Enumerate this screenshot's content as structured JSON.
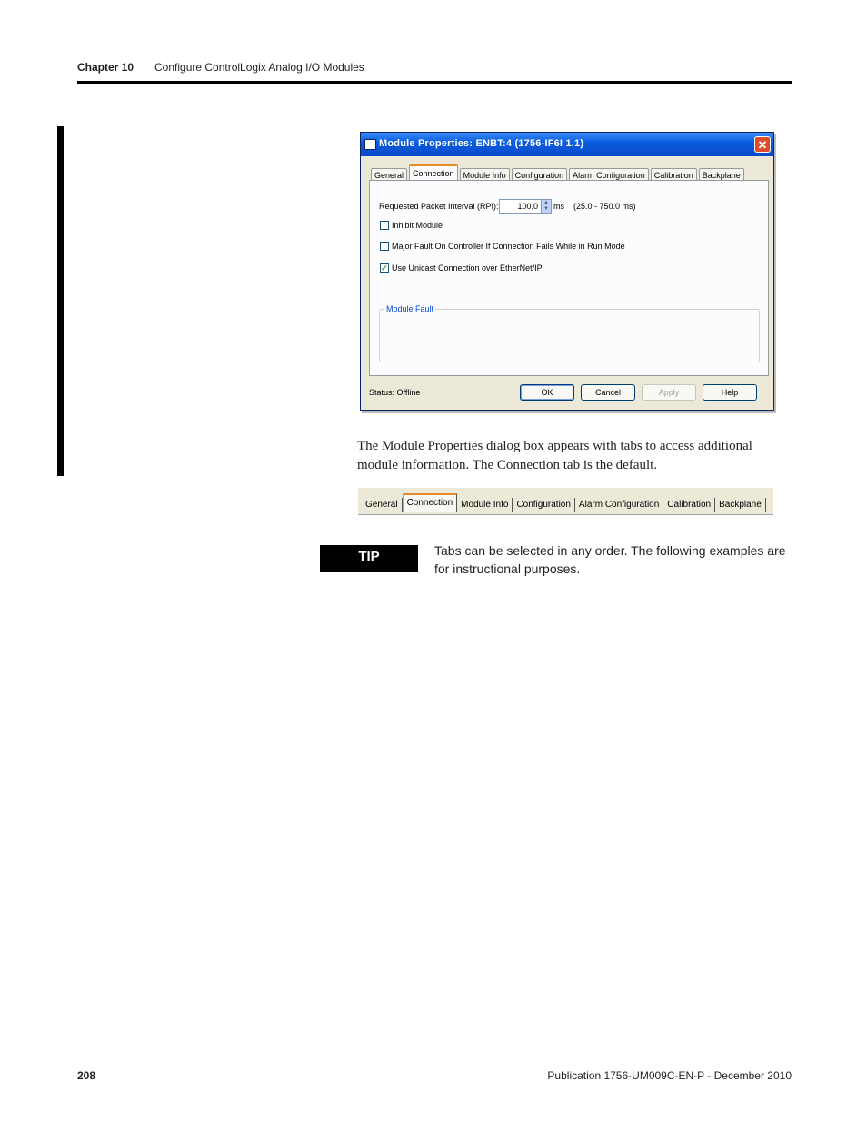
{
  "header": {
    "chapter": "Chapter 10",
    "title": "Configure ControlLogix Analog I/O Modules"
  },
  "dialog": {
    "title": "Module Properties: ENBT:4 (1756-IF6I 1.1)",
    "close_glyph": "✕",
    "tabs": [
      "General",
      "Connection",
      "Module Info",
      "Configuration",
      "Alarm Configuration",
      "Calibration",
      "Backplane"
    ],
    "active_tab": "Connection",
    "rpi": {
      "label": "Requested Packet Interval (RPI):",
      "value": "100.0",
      "unit": "ms",
      "range": "(25.0 - 750.0 ms)"
    },
    "options": [
      {
        "label": "Inhibit Module",
        "checked": false
      },
      {
        "label": "Major Fault On Controller If Connection Fails While in Run Mode",
        "checked": false
      },
      {
        "label": "Use Unicast Connection over EtherNet/IP",
        "checked": true
      }
    ],
    "check_glyph": "✓",
    "module_fault_label": "Module Fault",
    "status": "Status:  Offline",
    "buttons": {
      "ok": "OK",
      "cancel": "Cancel",
      "apply": "Apply",
      "help": "Help"
    }
  },
  "body_text": "The Module Properties dialog box appears with tabs to access additional module information. The Connection tab is the default.",
  "tab_strip": [
    "General",
    "Connection",
    "Module Info",
    "Configuration",
    "Alarm Configuration",
    "Calibration",
    "Backplane"
  ],
  "tip": {
    "label": "TIP",
    "text": "Tabs can be selected in any order. The following examples are for instructional purposes."
  },
  "footer": {
    "page_number": "208",
    "publication": "Publication 1756-UM009C-EN-P - December 2010"
  }
}
